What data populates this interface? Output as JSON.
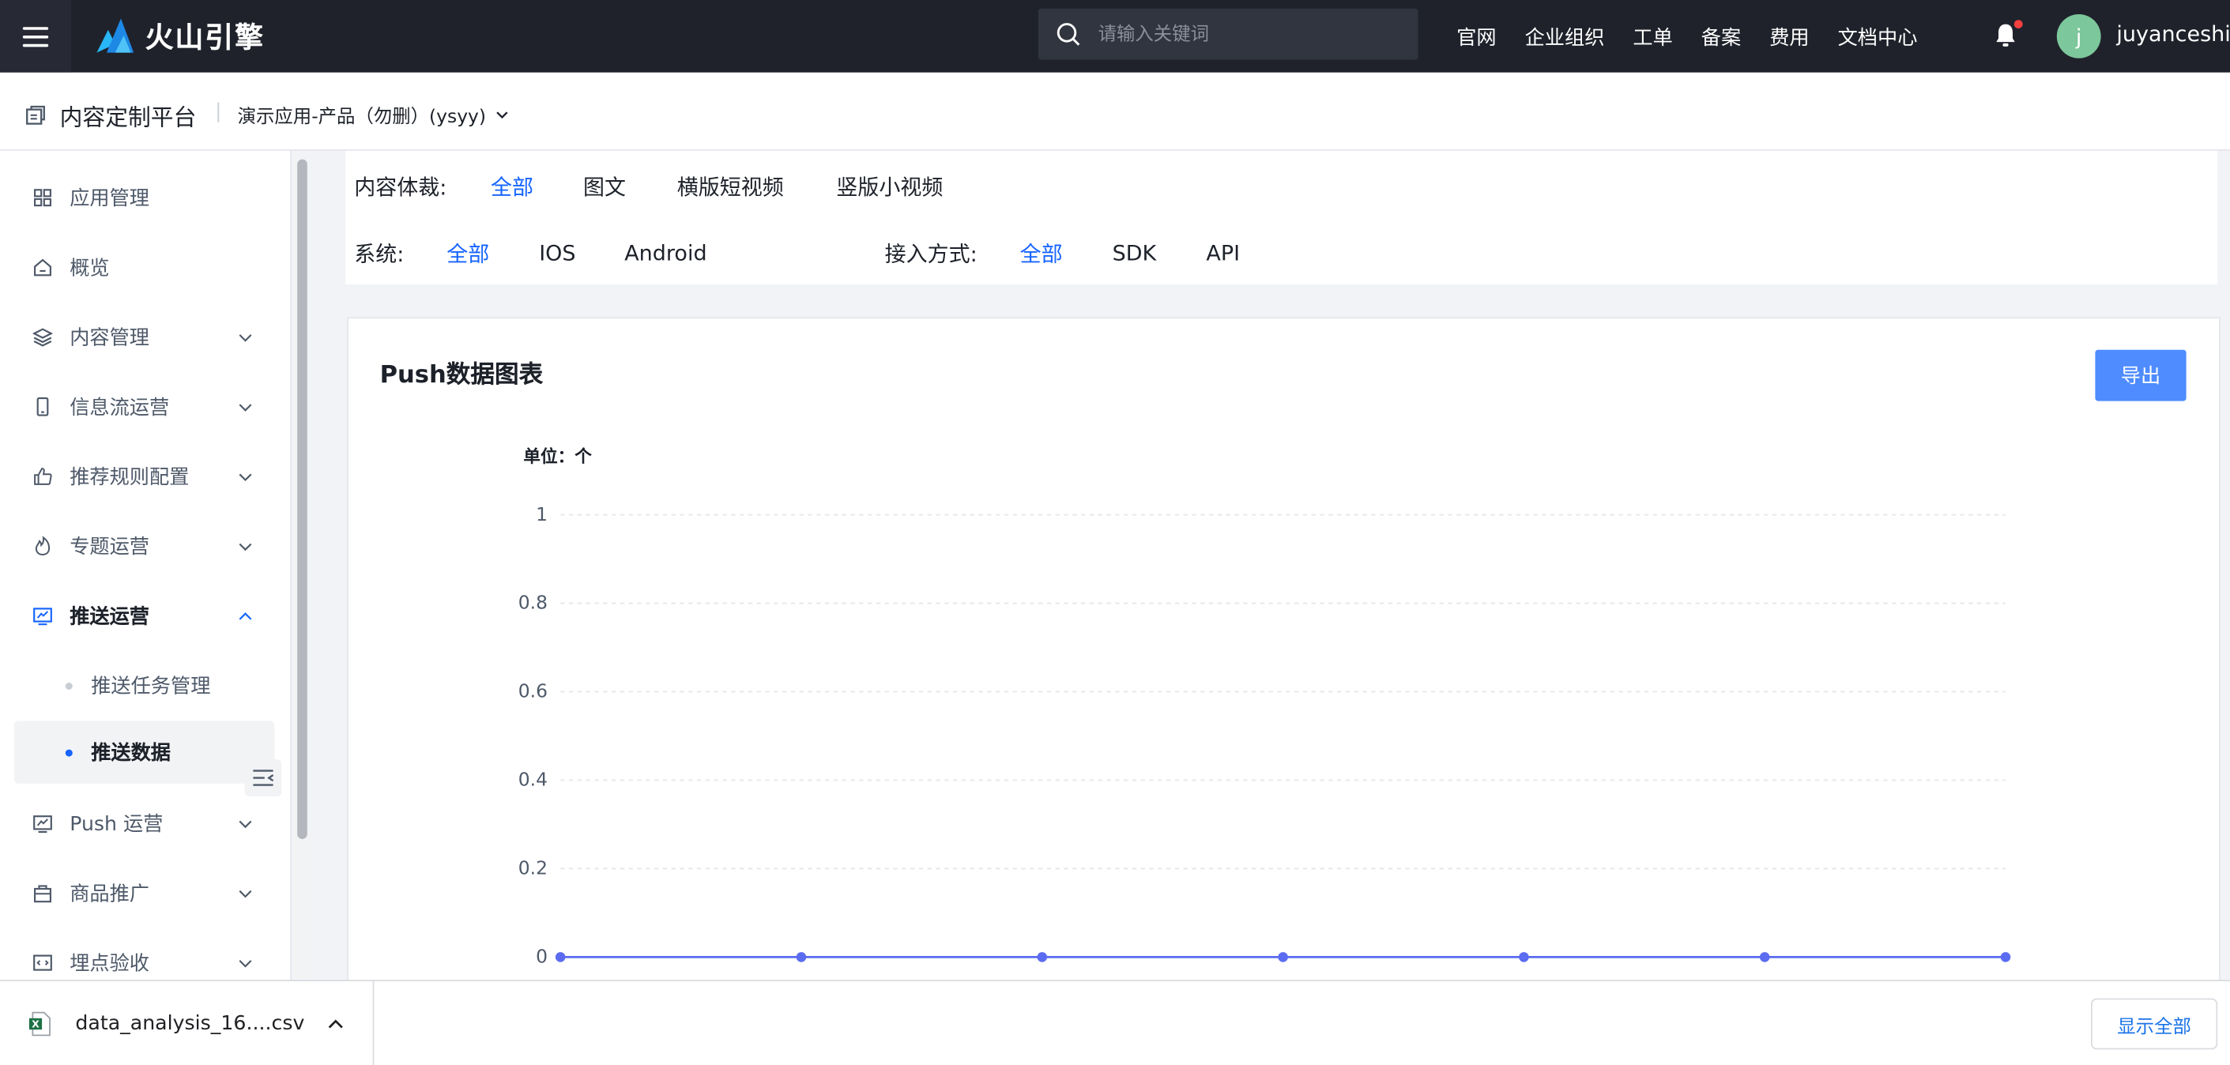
{
  "topbar": {
    "brand": "火山引擎",
    "search_placeholder": "请输入关键词",
    "nav": [
      "官网",
      "企业组织",
      "工单",
      "备案",
      "费用",
      "文档中心"
    ],
    "avatar_letter": "j",
    "username": "juyanceshi",
    "has_notification": true
  },
  "subheader": {
    "platform": "内容定制平台",
    "app": "演示应用-产品（勿删）(ysyy)"
  },
  "sidebar": {
    "items": [
      {
        "label": "应用管理",
        "icon": "grid-icon"
      },
      {
        "label": "概览",
        "icon": "home-icon"
      },
      {
        "label": "内容管理",
        "icon": "layers-icon",
        "expandable": true
      },
      {
        "label": "信息流运营",
        "icon": "phone-icon",
        "expandable": true
      },
      {
        "label": "推荐规则配置",
        "icon": "thumb-up-icon",
        "expandable": true
      },
      {
        "label": "专题运营",
        "icon": "flame-icon",
        "expandable": true
      },
      {
        "label": "推送运营",
        "icon": "push-icon",
        "expandable": true,
        "expanded": true
      },
      {
        "label": "Push 运营",
        "icon": "push-icon",
        "expandable": true
      },
      {
        "label": "商品推广",
        "icon": "bag-icon",
        "expandable": true
      },
      {
        "label": "埋点验收",
        "icon": "code-icon",
        "expandable": true
      }
    ],
    "sub_items": [
      {
        "label": "推送任务管理",
        "selected": false
      },
      {
        "label": "推送数据",
        "selected": true
      }
    ]
  },
  "filters": {
    "genre_label": "内容体裁:",
    "genre_options": [
      "全部",
      "图文",
      "横版短视频",
      "竖版小视频"
    ],
    "system_label": "系统:",
    "system_options": [
      "全部",
      "IOS",
      "Android"
    ],
    "access_label": "接入方式:",
    "access_options": [
      "全部",
      "SDK",
      "API"
    ],
    "selected": "全部"
  },
  "chart_card": {
    "title": "Push数据图表",
    "export_label": "导出",
    "unit_label": "单位：个"
  },
  "chart_data": {
    "type": "line",
    "ylim": [
      0,
      1
    ],
    "yticks": [
      "0",
      "0.2",
      "0.4",
      "0.6",
      "0.8",
      "1"
    ],
    "series": [
      {
        "values": [
          0,
          0,
          0,
          0,
          0,
          0,
          0
        ]
      }
    ],
    "grid": true,
    "color": "#5b6cf0"
  },
  "downloads": {
    "file": "data_analysis_16....csv",
    "show_all": "显示全部"
  }
}
